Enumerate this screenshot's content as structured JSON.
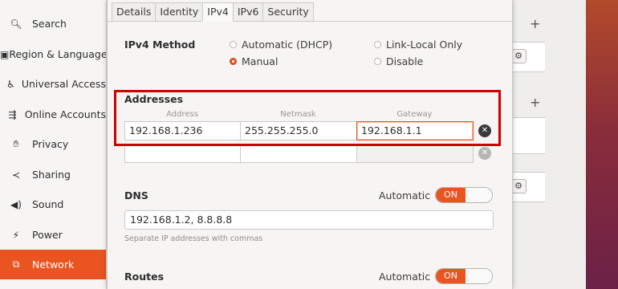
{
  "sidebar": {
    "items": [
      {
        "icon": "search-icon",
        "glyph": "🔍︎",
        "label": "Search"
      },
      {
        "icon": "region-icon",
        "glyph": "▣",
        "label": "Region & Language"
      },
      {
        "icon": "universal-access-icon",
        "glyph": "♿︎",
        "label": "Universal Access"
      },
      {
        "icon": "online-accounts-icon",
        "glyph": "⇶",
        "label": "Online Accounts"
      },
      {
        "icon": "privacy-icon",
        "glyph": "✋︎",
        "label": "Privacy"
      },
      {
        "icon": "sharing-icon",
        "glyph": "≺",
        "label": "Sharing"
      },
      {
        "icon": "sound-icon",
        "glyph": "◀)",
        "label": "Sound"
      },
      {
        "icon": "power-icon",
        "glyph": "⚡︎",
        "label": "Power"
      },
      {
        "icon": "network-icon",
        "glyph": "⧉",
        "label": "Network"
      }
    ],
    "active_index": 8
  },
  "background": {
    "plus": "+",
    "gear": "⚙"
  },
  "dialog": {
    "tabs": [
      "Details",
      "Identity",
      "IPv4",
      "IPv6",
      "Security"
    ],
    "active_tab": "IPv4",
    "ipv4_method": {
      "label": "IPv4 Method",
      "options": [
        "Automatic (DHCP)",
        "Link-Local Only",
        "Manual",
        "Disable"
      ],
      "selected": "Manual"
    },
    "addresses": {
      "label": "Addresses",
      "columns": [
        "Address",
        "Netmask",
        "Gateway"
      ],
      "rows": [
        {
          "address": "192.168.1.236",
          "netmask": "255.255.255.0",
          "gateway": "192.168.1.1"
        },
        {
          "address": "",
          "netmask": "",
          "gateway": ""
        }
      ],
      "delete_glyph": "✕"
    },
    "dns": {
      "label": "DNS",
      "auto_label": "Automatic",
      "switch_text": "ON",
      "value": "192.168.1.2, 8.8.8.8",
      "hint": "Separate IP addresses with commas"
    },
    "routes": {
      "label": "Routes",
      "auto_label": "Automatic",
      "switch_text": "ON"
    }
  },
  "colors": {
    "accent": "#e95420",
    "highlight_box": "#d00000"
  }
}
